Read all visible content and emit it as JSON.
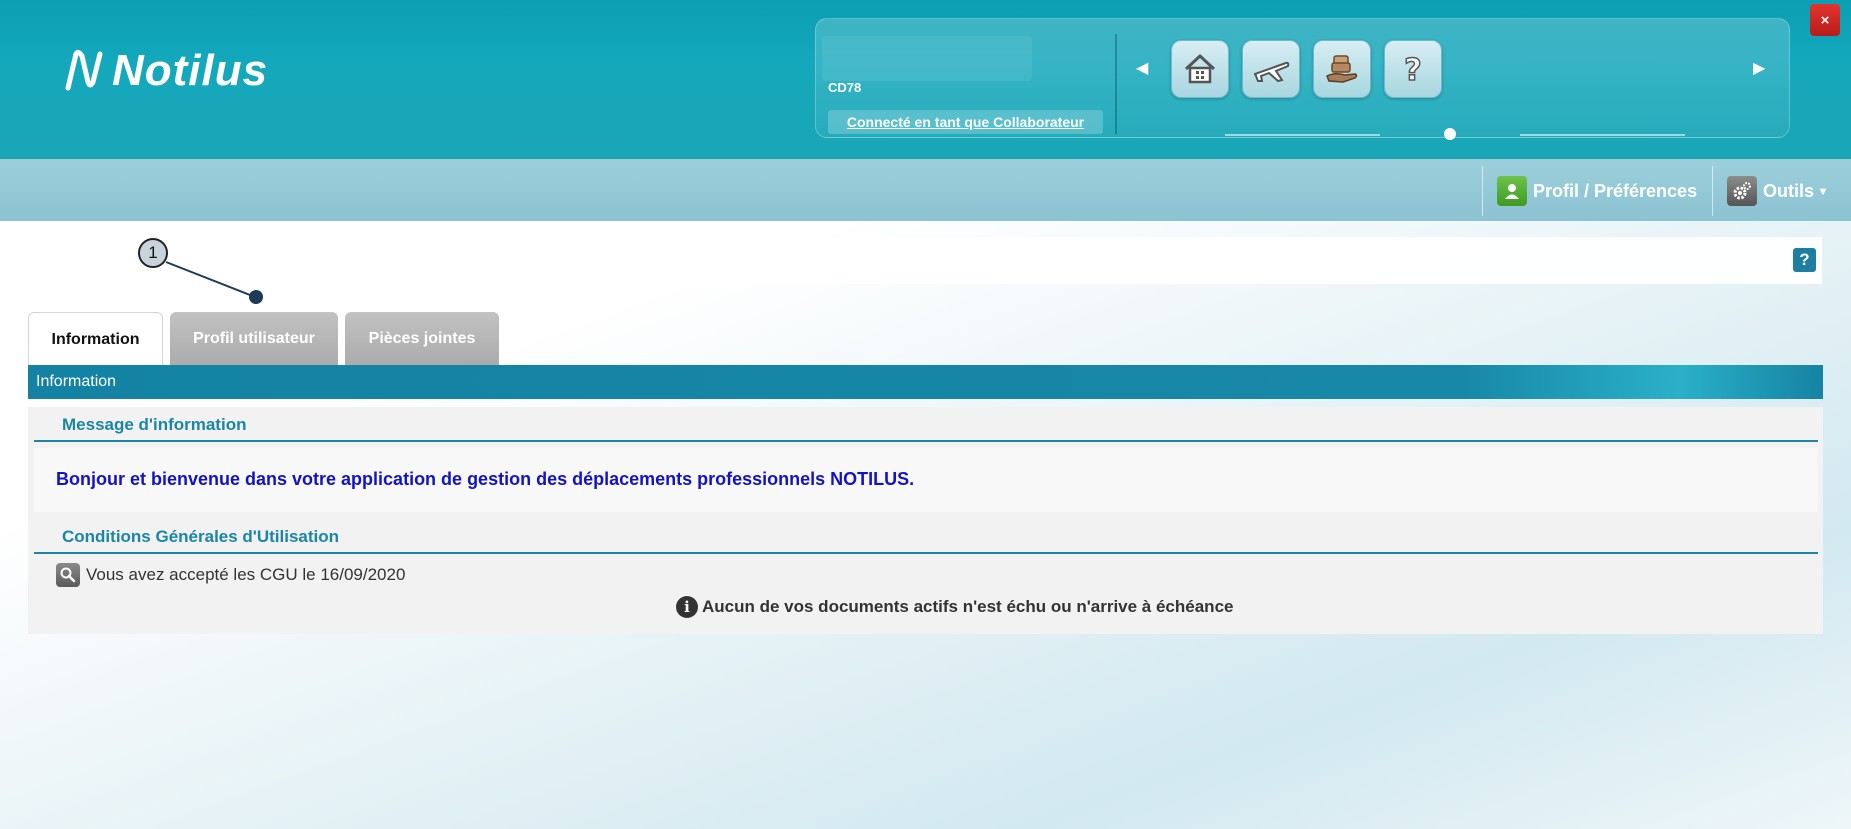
{
  "app": {
    "logo_text": "Notilus"
  },
  "header": {
    "account_code": "CD78",
    "connected_as": "Connecté en tant que Collaborateur",
    "nav_buttons": [
      {
        "name": "home-icon"
      },
      {
        "name": "plane-icon"
      },
      {
        "name": "hand-cash-icon"
      },
      {
        "name": "help-icon"
      }
    ],
    "close_label": "×"
  },
  "toolbar": {
    "profile_label": "Profil / Préférences",
    "tools_label": "Outils",
    "tools_caret": "▾"
  },
  "help_label": "?",
  "annotation": {
    "number": "1"
  },
  "tabs": [
    {
      "label": "Information",
      "active": true
    },
    {
      "label": "Profil utilisateur",
      "active": false
    },
    {
      "label": "Pièces jointes",
      "active": false
    }
  ],
  "section": {
    "title": "Information",
    "message_header": "Message d'information",
    "welcome_message": "Bonjour et bienvenue dans votre application de gestion des déplacements professionnels NOTILUS.",
    "cgu_header": "Conditions Générales d'Utilisation",
    "cgu_accepted": "Vous avez accepté les CGU le 16/09/2020",
    "documents_status": "Aucun de vos documents actifs n'est échu ou n'arrive à échéance",
    "info_glyph": "i"
  },
  "colors": {
    "header": "#14a8bc",
    "toolbar": "#8cc3d1",
    "section_bar": "#1888a8",
    "subheader_text": "#1a86a6",
    "welcome_text": "#1212c8",
    "close_button": "#d22a25"
  }
}
